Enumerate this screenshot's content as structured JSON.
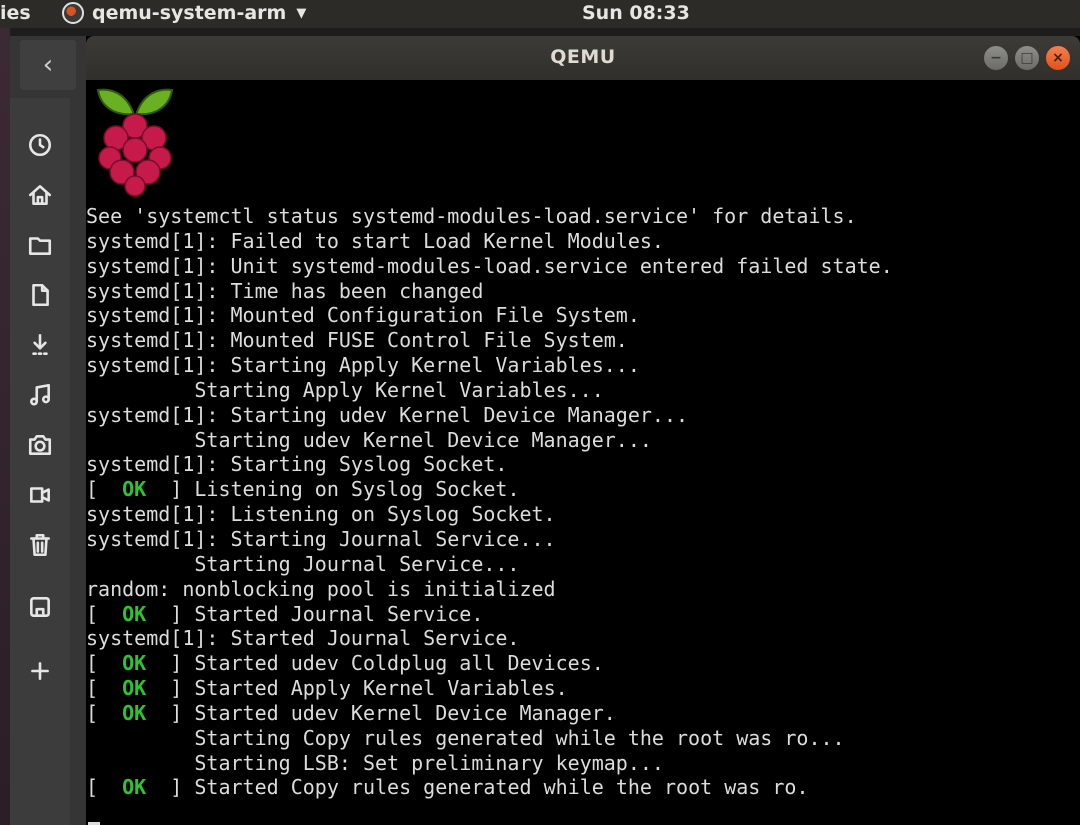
{
  "topbar": {
    "activities": "ies",
    "app_name": "qemu-system-arm",
    "app_caret": "▼",
    "clock": "Sun 08:33"
  },
  "dock": {
    "back": "‹",
    "items": [
      {
        "icon": "clock-icon"
      },
      {
        "icon": "home-icon"
      },
      {
        "icon": "folder-icon"
      },
      {
        "icon": "document-icon"
      },
      {
        "icon": "download-icon"
      },
      {
        "icon": "music-icon"
      },
      {
        "icon": "camera-icon"
      },
      {
        "icon": "video-icon"
      },
      {
        "icon": "trash-icon"
      },
      {
        "icon": "drive-icon"
      },
      {
        "icon": "plus-icon"
      }
    ]
  },
  "window": {
    "title": "QEMU",
    "controls": {
      "minimize": "−",
      "maximize": "□",
      "close": "×"
    }
  },
  "console": {
    "ok_color": "#2fc332",
    "lines": [
      {
        "text": "See 'systemctl status systemd-modules-load.service' for details."
      },
      {
        "text": "systemd[1]: Failed to start Load Kernel Modules."
      },
      {
        "text": "systemd[1]: Unit systemd-modules-load.service entered failed state."
      },
      {
        "text": "systemd[1]: Time has been changed"
      },
      {
        "text": "systemd[1]: Mounted Configuration File System."
      },
      {
        "text": "systemd[1]: Mounted FUSE Control File System."
      },
      {
        "text": "systemd[1]: Starting Apply Kernel Variables..."
      },
      {
        "text": "         Starting Apply Kernel Variables..."
      },
      {
        "text": "systemd[1]: Starting udev Kernel Device Manager..."
      },
      {
        "text": "         Starting udev Kernel Device Manager..."
      },
      {
        "text": "systemd[1]: Starting Syslog Socket."
      },
      {
        "status": "OK",
        "text": "Listening on Syslog Socket."
      },
      {
        "text": "systemd[1]: Listening on Syslog Socket."
      },
      {
        "text": "systemd[1]: Starting Journal Service..."
      },
      {
        "text": "         Starting Journal Service..."
      },
      {
        "text": "random: nonblocking pool is initialized"
      },
      {
        "status": "OK",
        "text": "Started Journal Service."
      },
      {
        "text": "systemd[1]: Started Journal Service."
      },
      {
        "status": "OK",
        "text": "Started udev Coldplug all Devices."
      },
      {
        "status": "OK",
        "text": "Started Apply Kernel Variables."
      },
      {
        "status": "OK",
        "text": "Started udev Kernel Device Manager."
      },
      {
        "text": "         Starting Copy rules generated while the root was ro..."
      },
      {
        "text": "         Starting LSB: Set preliminary keymap..."
      },
      {
        "status": "OK",
        "text": "Started Copy rules generated while the root was ro."
      }
    ]
  }
}
